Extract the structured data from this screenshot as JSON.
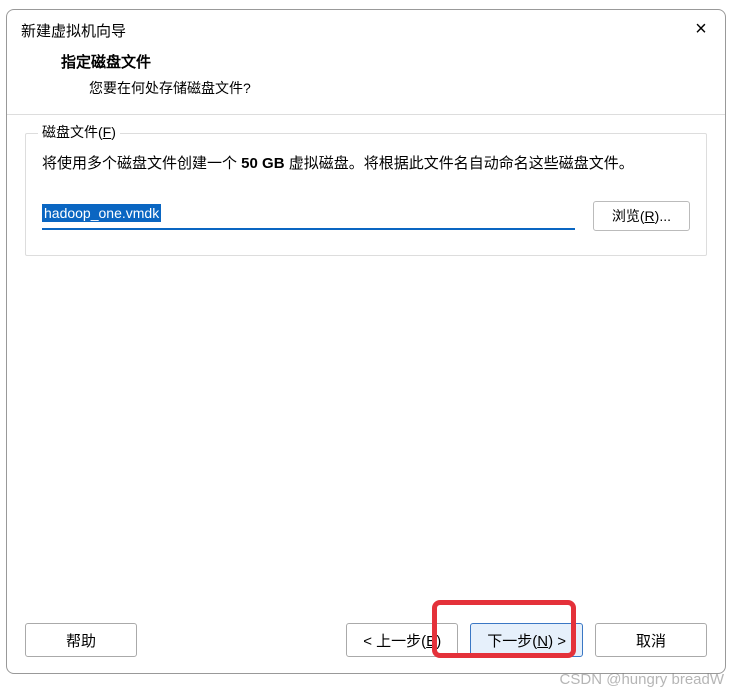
{
  "header": {
    "title": "新建虚拟机向导",
    "close_aria": "×"
  },
  "subheader": {
    "title": "指定磁盘文件",
    "desc": "您要在何处存储磁盘文件?"
  },
  "fieldset": {
    "legend_prefix": "磁盘文件(",
    "legend_key": "F",
    "legend_suffix": ")",
    "desc_part1": "将使用多个磁盘文件创建一个 ",
    "desc_size": "50 GB",
    "desc_part2": " 虚拟磁盘。将根据此文件名自动命名这些磁盘文件。",
    "file_value": "hadoop_one.vmdk",
    "browse_prefix": "浏览(",
    "browse_key": "R",
    "browse_suffix": ")..."
  },
  "footer": {
    "help": "帮助",
    "back_prefix": "< 上一步(",
    "back_key": "B",
    "back_suffix": ")",
    "next_prefix": "下一步(",
    "next_key": "N",
    "next_suffix": ") >",
    "cancel": "取消"
  },
  "watermark": "CSDN @hungry breadW"
}
